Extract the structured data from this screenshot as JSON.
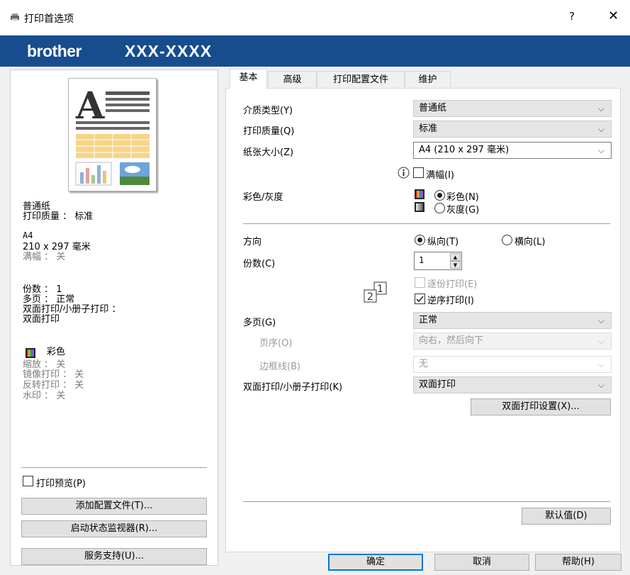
{
  "window": {
    "title": "打印首选项",
    "help": "?",
    "close": "✕"
  },
  "brand": {
    "logo": "brother",
    "model": "XXX-XXXX"
  },
  "summary": {
    "media": "普通纸",
    "quality": "打印质量 ： 标准",
    "paper": "A4",
    "size": "210 x 297 毫米",
    "borderless": "满幅 ： 关",
    "copies": "份数 ： 1",
    "multipage": "多页 ： 正常",
    "duplex_label": "双面打印/小册子打印 ：",
    "duplex_value": "双面打印",
    "color": "彩色",
    "scale": "缩放 ： 关",
    "mirror": "镜像打印 ： 关",
    "reverse": "反转打印 ： 关",
    "watermark": "水印 ： 关"
  },
  "left": {
    "print_preview": "打印预览(P)",
    "add_profile": "添加配置文件(T)...",
    "status_monitor": "启动状态监视器(R)...",
    "support": "服务支持(U)..."
  },
  "tabs": [
    "基本",
    "高级",
    "打印配置文件",
    "维护"
  ],
  "basic": {
    "media_label": "介质类型(Y)",
    "media_value": "普通纸",
    "quality_label": "打印质量(Q)",
    "quality_value": "标准",
    "paper_label": "纸张大小(Z)",
    "paper_value": "A4 (210 x 297 毫米)",
    "borderless": "满幅(I)",
    "color_label": "彩色/灰度",
    "color_opt": "彩色(N)",
    "gray_opt": "灰度(G)",
    "orient_label": "方向",
    "portrait": "纵向(T)",
    "landscape": "横向(L)",
    "copies_label": "份数(C)",
    "copies_value": "1",
    "collate": "逐份打印(E)",
    "reverse_order": "逆序打印(I)",
    "multipage_label": "多页(G)",
    "multipage_value": "正常",
    "page_order_label": "页序(O)",
    "page_order_value": "向右，然后向下",
    "border_label": "边框线(B)",
    "border_value": "无",
    "duplex_label": "双面打印/小册子打印(K)",
    "duplex_value": "双面打印",
    "duplex_settings": "双面打印设置(X)...",
    "defaults": "默认值(D)"
  },
  "footer": {
    "ok": "确定",
    "cancel": "取消",
    "help": "帮助(H)"
  }
}
